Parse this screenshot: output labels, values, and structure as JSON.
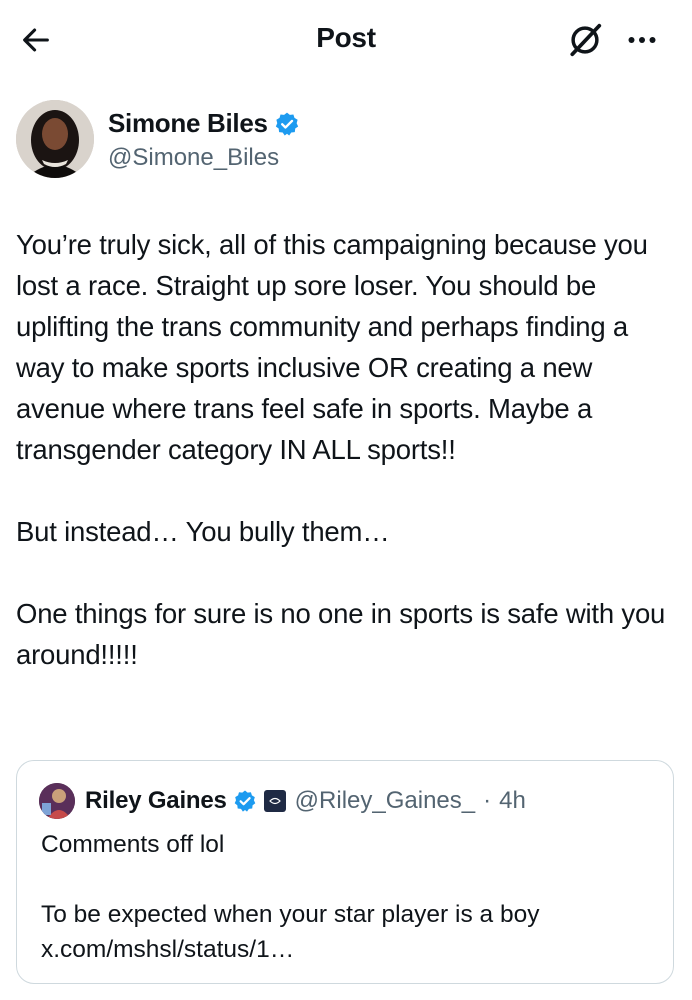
{
  "header": {
    "title": "Post",
    "back_icon": "arrow-left-icon",
    "grok_icon": "grok-icon",
    "more_icon": "more-horizontal-icon"
  },
  "author": {
    "name": "Simone Biles",
    "handle": "@Simone_Biles",
    "verified": true,
    "verified_color": "#1d9bf0"
  },
  "tweet": {
    "paragraphs": [
      "You’re truly sick, all of this campaigning because you lost a race. Straight up sore loser. You should be uplifting the trans community and perhaps finding a way to make sports inclusive OR creating a new avenue where trans feel safe in sports. Maybe a transgender category IN ALL sports!!",
      "But instead… You bully them…",
      "One things for sure is no one in sports is safe with you around!!!!!"
    ]
  },
  "quote": {
    "name": "Riley Gaines",
    "verified": true,
    "handle": "@Riley_Gaines_",
    "separator": "·",
    "time": "4h",
    "paragraphs": [
      "Comments off lol",
      "To be expected when your star player is a boy x.com/mshsl/status/1…"
    ]
  }
}
